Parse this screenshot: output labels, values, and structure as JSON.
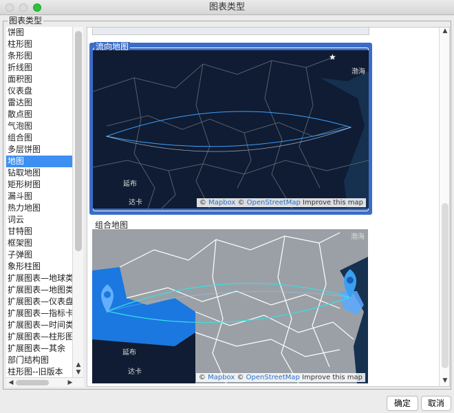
{
  "window": {
    "title": "图表类型"
  },
  "group": {
    "legend": "图表类型"
  },
  "chart_types": [
    "饼图",
    "柱形图",
    "条形图",
    "折线图",
    "面积图",
    "仪表盘",
    "雷达图",
    "散点图",
    "气泡图",
    "组合图",
    "多层饼图",
    "地图",
    "钻取地图",
    "矩形树图",
    "漏斗图",
    "热力地图",
    "词云",
    "甘特图",
    "框架图",
    "子弹图",
    "象形柱图",
    "扩展图表—地球类",
    "扩展图表—地图类",
    "扩展图表—仪表盘",
    "扩展图表—指标卡",
    "扩展图表—时间类",
    "扩展图表—柱形图",
    "扩展图表—其余",
    "部门结构图",
    "柱形图--旧版本"
  ],
  "selected_type": "地图",
  "thumbnails": [
    {
      "label": "流向地图",
      "selected": true
    },
    {
      "label": "组合地图",
      "selected": false
    }
  ],
  "map_labels": {
    "sea": "渤海",
    "city1": "延布",
    "city2": "达卡"
  },
  "attribution": {
    "prefix": "©",
    "mapbox": "Mapbox",
    "sep": "©",
    "osm": "OpenStreetMap",
    "improve": "Improve this map"
  },
  "buttons": {
    "ok": "确定",
    "cancel": "取消"
  },
  "colors": {
    "selection": "#3d8ff2",
    "thumb_selected": "#3b6cc7",
    "dark_map": "#0f1c33",
    "flow_line": "#3fa0ff",
    "combo_line": "#37e0e0",
    "marker": "#3aa0f0"
  }
}
